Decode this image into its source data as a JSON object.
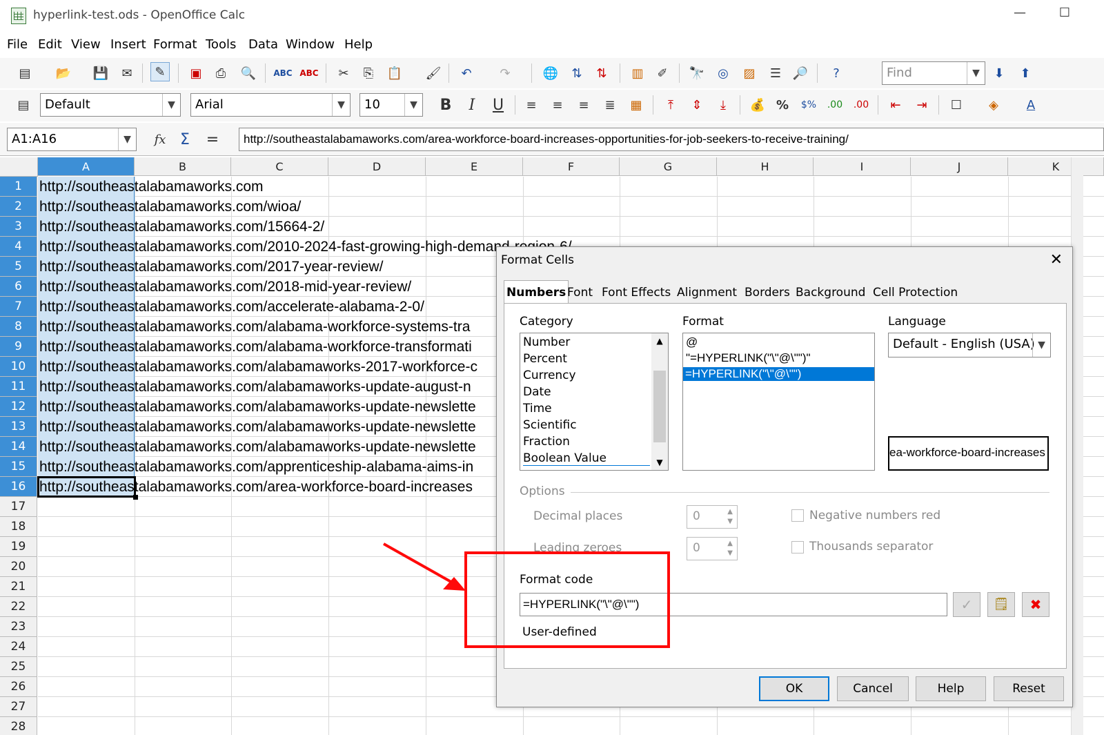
{
  "window": {
    "title": "hyperlink-test.ods - OpenOffice Calc"
  },
  "menu": [
    {
      "label": "File"
    },
    {
      "label": "Edit"
    },
    {
      "label": "View"
    },
    {
      "label": "Insert"
    },
    {
      "label": "Format"
    },
    {
      "label": "Tools"
    },
    {
      "label": "Data"
    },
    {
      "label": "Window"
    },
    {
      "label": "Help"
    }
  ],
  "toolbar": {
    "find_placeholder": "Find",
    "style": "Default",
    "font": "Arial",
    "size": "10",
    "bold": "B",
    "italic": "I",
    "underline": "U",
    "percent": "%"
  },
  "formula_bar": {
    "name_box": "A1:A16",
    "equals": "=",
    "content": "http://southeastalabamaworks.com/area-workforce-board-increases-opportunities-for-job-seekers-to-receive-training/"
  },
  "sheet": {
    "columns": [
      "A",
      "B",
      "C",
      "D",
      "E",
      "F",
      "G",
      "H",
      "I",
      "J",
      "K"
    ],
    "selected_column": "A",
    "selected_rows": "1-16",
    "active_cell": "A16",
    "rows": [
      "1",
      "2",
      "3",
      "4",
      "5",
      "6",
      "7",
      "8",
      "9",
      "10",
      "11",
      "12",
      "13",
      "14",
      "15",
      "16",
      "17",
      "18",
      "19",
      "20",
      "21",
      "22",
      "23",
      "24",
      "25",
      "26",
      "27",
      "28"
    ],
    "cells": [
      "http://southeastalabamaworks.com",
      "http://southeastalabamaworks.com/wioa/",
      "http://southeastalabamaworks.com/15664-2/",
      "http://southeastalabamaworks.com/2010-2024-fast-growing-high-demand-region-6/",
      "http://southeastalabamaworks.com/2017-year-review/",
      "http://southeastalabamaworks.com/2018-mid-year-review/",
      "http://southeastalabamaworks.com/accelerate-alabama-2-0/",
      "http://southeastalabamaworks.com/alabama-workforce-systems-tra",
      "http://southeastalabamaworks.com/alabama-workforce-transformati",
      "http://southeastalabamaworks.com/alabamaworks-2017-workforce-c",
      "http://southeastalabamaworks.com/alabamaworks-update-august-n",
      "http://southeastalabamaworks.com/alabamaworks-update-newslette",
      "http://southeastalabamaworks.com/alabamaworks-update-newslette",
      "http://southeastalabamaworks.com/alabamaworks-update-newslette",
      "http://southeastalabamaworks.com/apprenticeship-alabama-aims-in",
      "http://southeastalabamaworks.com/area-workforce-board-increases"
    ]
  },
  "dialog": {
    "title": "Format Cells",
    "tabs": [
      {
        "label": "Numbers"
      },
      {
        "label": "Font"
      },
      {
        "label": "Font Effects"
      },
      {
        "label": "Alignment"
      },
      {
        "label": "Borders"
      },
      {
        "label": "Background"
      },
      {
        "label": "Cell Protection"
      }
    ],
    "active_tab": "Numbers",
    "category_label": "Category",
    "categories": [
      "Number",
      "Percent",
      "Currency",
      "Date",
      "Time",
      "Scientific",
      "Fraction",
      "Boolean Value"
    ],
    "format_label": "Format",
    "formats": [
      "@",
      "\"=HYPERLINK(\"\\\"@\\\"\")\"",
      "=HYPERLINK(\"\\\"@\\\"\")"
    ],
    "selected_format": "=HYPERLINK(\"\\\"@\\\"\")",
    "language_label": "Language",
    "language_value": "Default - English (USA)",
    "preview": "ea-workforce-board-increases",
    "options_label": "Options",
    "decimal_places_label": "Decimal places",
    "decimal_places_value": "0",
    "leading_zeroes_label": "Leading zeroes",
    "leading_zeroes_value": "0",
    "negative_red_label": "Negative numbers red",
    "thousands_label": "Thousands separator",
    "format_code_label": "Format code",
    "format_code_value": "=HYPERLINK(\"\\\"@\\\"\")",
    "format_comment": "User-defined",
    "buttons": {
      "ok": "OK",
      "cancel": "Cancel",
      "help": "Help",
      "reset": "Reset"
    }
  },
  "annotation": {
    "color": "#ff0a0a"
  },
  "colors": {
    "selection": "#3d8fd6",
    "selection_light": "#cfe3f4",
    "list_select": "#0078d7"
  }
}
